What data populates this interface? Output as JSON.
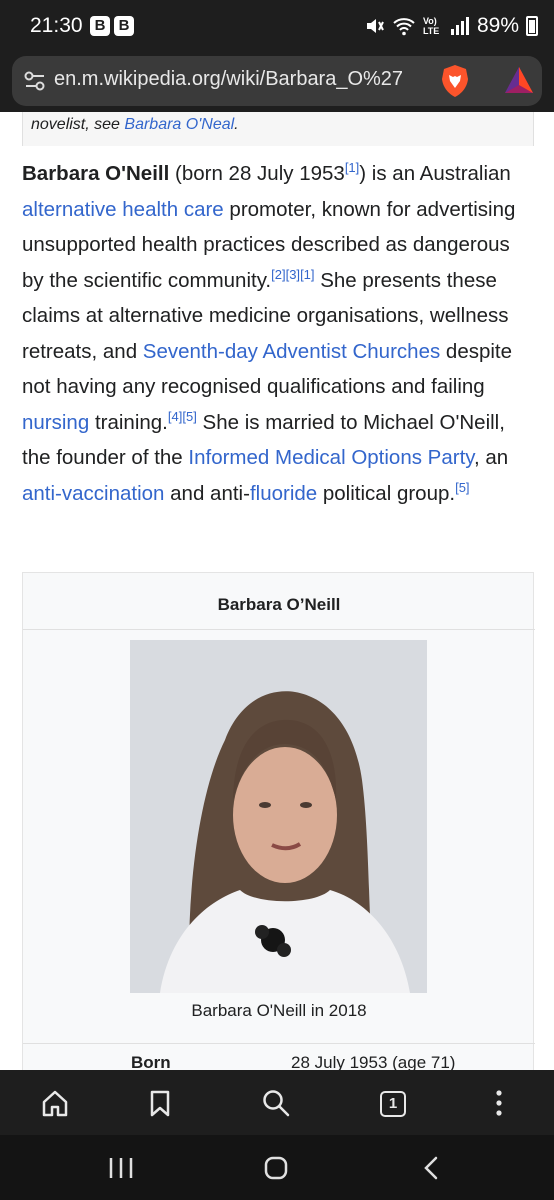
{
  "status_bar": {
    "time": "21:30",
    "badge_1": "B",
    "badge_2": "B",
    "battery": "89%",
    "network_label": "Vo) LTE"
  },
  "browser": {
    "url": "en.m.wikipedia.org/wiki/Barbara_O%27"
  },
  "article": {
    "hatnote_prefix": "novelist, see ",
    "hatnote_link": "Barbara O'Neal",
    "hatnote_suffix": ".",
    "subject_name": "Barbara O'Neill",
    "t1": " (born 28 July 1953",
    "ref_1": "[1]",
    "t2": ") is an Australian ",
    "link_alt_health": "alternative health care",
    "t3": " promoter, known for advertising unsupported health practices described as dangerous by the scientific community.",
    "ref_2": "[2]",
    "ref_3": "[3]",
    "ref_1b": "[1]",
    "t4": " She presents these claims at alternative medicine organisations, wellness retreats, and ",
    "link_sda": "Seventh-day Adventist Churches",
    "t5": " despite not having any recognised qualifications and failing ",
    "link_nursing": "nursing",
    "t6": " training.",
    "ref_4": "[4]",
    "ref_5": "[5]",
    "t7": " She is married to Michael O'Neill, the founder of the ",
    "link_party": "Informed Medical Options Party",
    "t8": ", an ",
    "link_antivax": "anti-vaccination",
    "t9": " and anti-",
    "link_fluoride": "fluoride",
    "t10": " political group.",
    "ref_5b": "[5]"
  },
  "infobox": {
    "title": "Barbara O’Neill",
    "caption": "Barbara O'Neill in 2018",
    "born_label": "Born",
    "born_value": "28 July 1953 (age 71)"
  },
  "toolbar": {
    "tab_count": "1"
  },
  "colors": {
    "link": "#3366cc",
    "chrome": "#1e1e1e",
    "brave_orange": "#fb542b"
  }
}
